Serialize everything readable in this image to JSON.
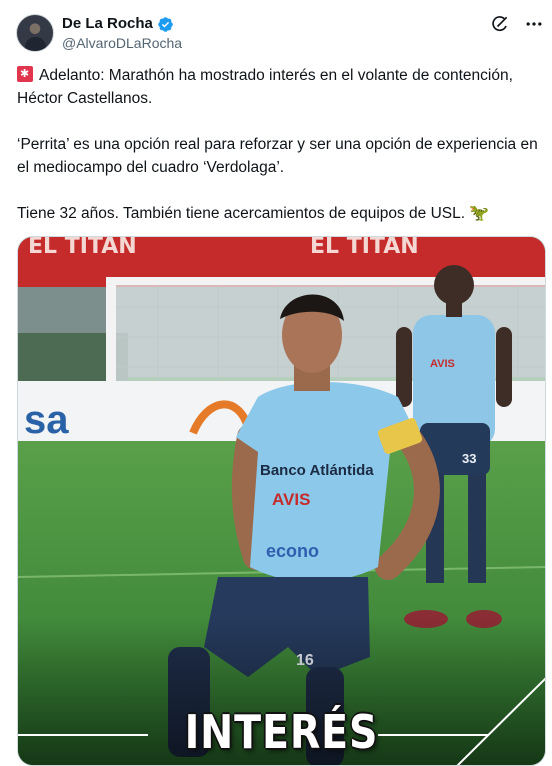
{
  "author": {
    "name": "De La Rocha",
    "handle": "@AlvaroDLaRocha",
    "avatar_icon": "profile-photo",
    "verified_color": "#1d9bf0"
  },
  "actions": {
    "grok_icon": "grok-icon",
    "more_icon": "more-dots-icon"
  },
  "tweet": {
    "line1": "Adelanto: Marathón ha mostrado interés en el volante de contención, Héctor Castellanos.",
    "line2": "‘Perrita’ es una opción real para reforzar y ser una opción de experiencia en el mediocampo del cuadro ‘Verdolaga’.",
    "line3": "Tiene 32 años. También tiene acercamientos de equipos de USL.",
    "dino_emoji": "🦖"
  },
  "media": {
    "caption": "INTERÉS",
    "banner_left": "EL TITAN",
    "banner_right": "EL TITAN",
    "ad_left": "sa",
    "ad_right": "AVIS",
    "jersey_sponsor": "Banco Atlántida",
    "jersey_avis": "AVIS",
    "jersey_econo": "econo",
    "player_number": "16",
    "back_player_number": "33"
  }
}
